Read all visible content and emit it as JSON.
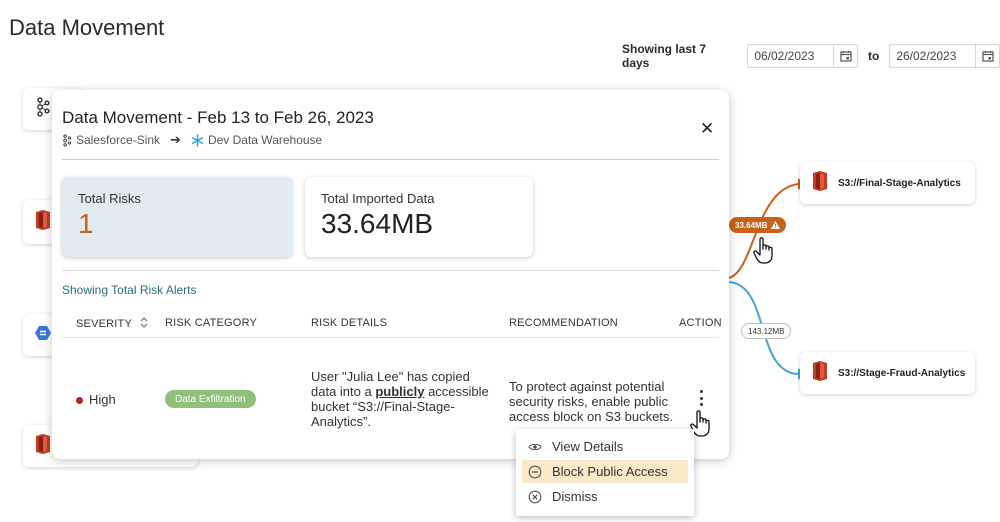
{
  "page": {
    "title": "Data Movement"
  },
  "date_range": {
    "label": "Showing last 7 days",
    "from": "06/02/2023",
    "to_label": "to",
    "to": "26/02/2023",
    "calendar_icon": "calendar-icon"
  },
  "nodes": {
    "right": [
      {
        "label": "S3://Final-Stage-Analytics",
        "icon": "s3-bucket-icon"
      },
      {
        "label": "S3://Stage-Fraud-Analytics",
        "icon": "s3-bucket-icon"
      }
    ],
    "left_icons": [
      "kafka-icon",
      "s3-bucket-icon",
      "database-icon",
      "s3-bucket-icon"
    ]
  },
  "flows": [
    {
      "size": "33.64MB",
      "risk": true,
      "color": "#c8611a",
      "icon": "warning-icon"
    },
    {
      "size": "143.12MB",
      "risk": false,
      "color": "#4aa3d1"
    }
  ],
  "modal": {
    "title": "Data Movement - Feb 13 to Feb 26, 2023",
    "source": "Salesforce-Sink",
    "destination": "Dev Data Warehouse",
    "close_icon": "close-icon",
    "total_risks_label": "Total Risks",
    "total_risks_value": "1",
    "total_imported_label": "Total Imported Data",
    "total_imported_value": "33.64MB",
    "section_title": "Showing Total Risk Alerts",
    "columns": [
      "SEVERITY",
      "RISK CATEGORY",
      "RISK DETAILS",
      "RECOMMENDATION",
      "ACTION"
    ],
    "rows": [
      {
        "severity": "High",
        "severity_color": "#b0201c",
        "category": "Data Exfiltration",
        "details_pre": "User \"Julia Lee\" has copied data into a ",
        "details_bold": "publicly",
        "details_post": " accessible bucket “S3://Final-Stage-Analytics”.",
        "recommendation": "To protect against potential security risks, enable public access block on S3 buckets."
      }
    ]
  },
  "action_menu": {
    "items": [
      {
        "label": "View Details",
        "icon": "eye-icon"
      },
      {
        "label": "Block Public Access",
        "icon": "minus-circle-icon",
        "highlighted": true
      },
      {
        "label": "Dismiss",
        "icon": "x-circle-icon"
      }
    ]
  },
  "colors": {
    "risk": "#c8611a",
    "normal_flow": "#4aa3d1",
    "accent_teal": "#2a6f6f",
    "pill_green": "#8fbf7a",
    "highlight": "#fbeac8"
  }
}
